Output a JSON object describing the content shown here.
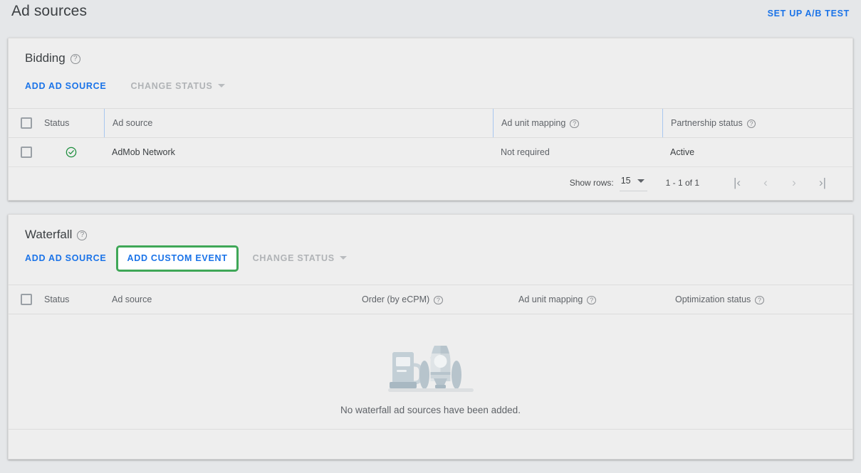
{
  "header": {
    "title": "Ad sources",
    "ab_test_label": "SET UP A/B TEST"
  },
  "bidding": {
    "title": "Bidding",
    "help_glyph": "?",
    "actions": {
      "add_ad_source": "ADD AD SOURCE",
      "change_status": "CHANGE STATUS"
    },
    "columns": [
      "Status",
      "Ad source",
      "Ad unit mapping",
      "Partnership status"
    ],
    "rows": [
      {
        "status": "active",
        "ad_source": "AdMob Network",
        "ad_unit_mapping": "Not required",
        "partnership_status": "Active"
      }
    ],
    "pagination": {
      "show_rows_label": "Show rows:",
      "rows_per_page": "15",
      "range": "1 - 1 of 1",
      "first_glyph": "|‹",
      "prev_glyph": "‹",
      "next_glyph": "›",
      "last_glyph": "›|"
    }
  },
  "waterfall": {
    "title": "Waterfall",
    "help_glyph": "?",
    "actions": {
      "add_ad_source": "ADD AD SOURCE",
      "add_custom_event": "ADD CUSTOM EVENT",
      "change_status": "CHANGE STATUS"
    },
    "columns": [
      "Status",
      "Ad source",
      "Order (by eCPM)",
      "Ad unit mapping",
      "Optimization status"
    ],
    "empty_message": "No waterfall ad sources have been added."
  },
  "colors": {
    "page_background": "#e5e7e9",
    "card_background": "#eeeeee",
    "link_blue": "#1a73e8",
    "highlight_green": "#3fa757",
    "status_green": "#34a853",
    "text_primary": "#3c4043",
    "text_secondary": "#5f6368",
    "disabled_gray": "#b0b3b6",
    "illustration_light": "#dfe4e7",
    "illustration_mid": "#c9d3d9",
    "illustration_dark": "#a8b8c2"
  },
  "illustration": {
    "name": "rocket-with-fuel-pump"
  }
}
